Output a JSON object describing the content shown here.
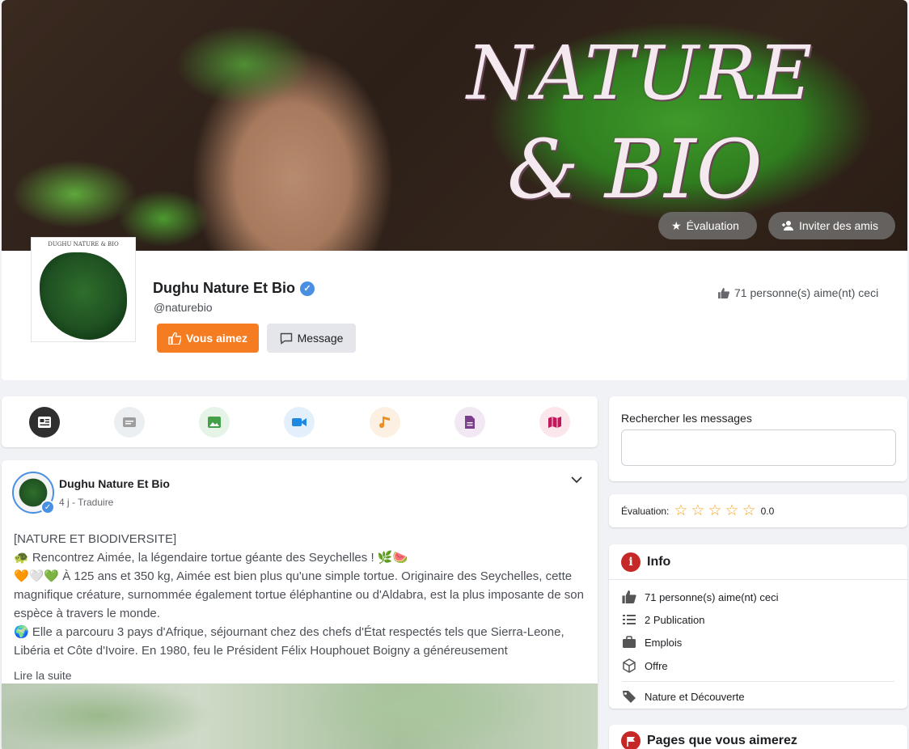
{
  "cover": {
    "title_line1": "NATURE",
    "title_line2": "& BIO",
    "rate_label": "Évaluation",
    "invite_label": "Inviter des amis"
  },
  "profile": {
    "pic_caption": "DUGHU NATURE & BIO",
    "name": "Dughu Nature Et Bio",
    "handle": "@naturebio",
    "like_button": "Vous aimez",
    "message_button": "Message",
    "likes_text": "71 personne(s) aime(nt) ceci"
  },
  "tabs": [
    {
      "icon": "feed-icon",
      "active": true
    },
    {
      "icon": "text-icon"
    },
    {
      "icon": "photo-icon"
    },
    {
      "icon": "video-icon"
    },
    {
      "icon": "music-icon"
    },
    {
      "icon": "document-icon"
    },
    {
      "icon": "map-icon"
    }
  ],
  "post": {
    "author": "Dughu Nature Et Bio",
    "meta": "4 j - Traduire",
    "lines": [
      "[NATURE ET BIODIVERSITE]",
      "🐢 Rencontrez Aimée, la légendaire tortue géante des Seychelles ! 🌿🍉",
      "🧡🤍💚 À 125 ans et 350 kg, Aimée est bien plus qu'une simple tortue. Originaire des Seychelles, cette magnifique créature, surnommée également tortue éléphantine ou d'Aldabra, est la plus imposante de son espèce à travers le monde.",
      "🌍 Elle a parcouru 3 pays d'Afrique, séjournant chez des chefs d'État respectés tels que Sierra-Leone, Libéria et Côte d'Ivoire. En 1980, feu le Président Félix Houphouet Boigny a généreusement"
    ],
    "read_more": "Lire la suite"
  },
  "search": {
    "label": "Rechercher les messages",
    "placeholder": ""
  },
  "rating": {
    "label": "Évaluation:",
    "value": "0.0",
    "stars": 0
  },
  "info": {
    "title": "Info",
    "rows": [
      {
        "icon": "thumbs-up-icon",
        "text": "71 personne(s) aime(nt) ceci"
      },
      {
        "icon": "list-icon",
        "text": "2 Publication"
      },
      {
        "icon": "briefcase-icon",
        "text": "Emplois"
      },
      {
        "icon": "box-icon",
        "text": "Offre"
      },
      {
        "icon": "tag-icon",
        "text": "Nature et Découverte"
      }
    ]
  },
  "pages": {
    "title": "Pages que vous aimerez"
  },
  "colors": {
    "accent": "#f57c20",
    "verified": "#4a90e2",
    "info_red": "#c62828",
    "star": "#f5a623"
  }
}
